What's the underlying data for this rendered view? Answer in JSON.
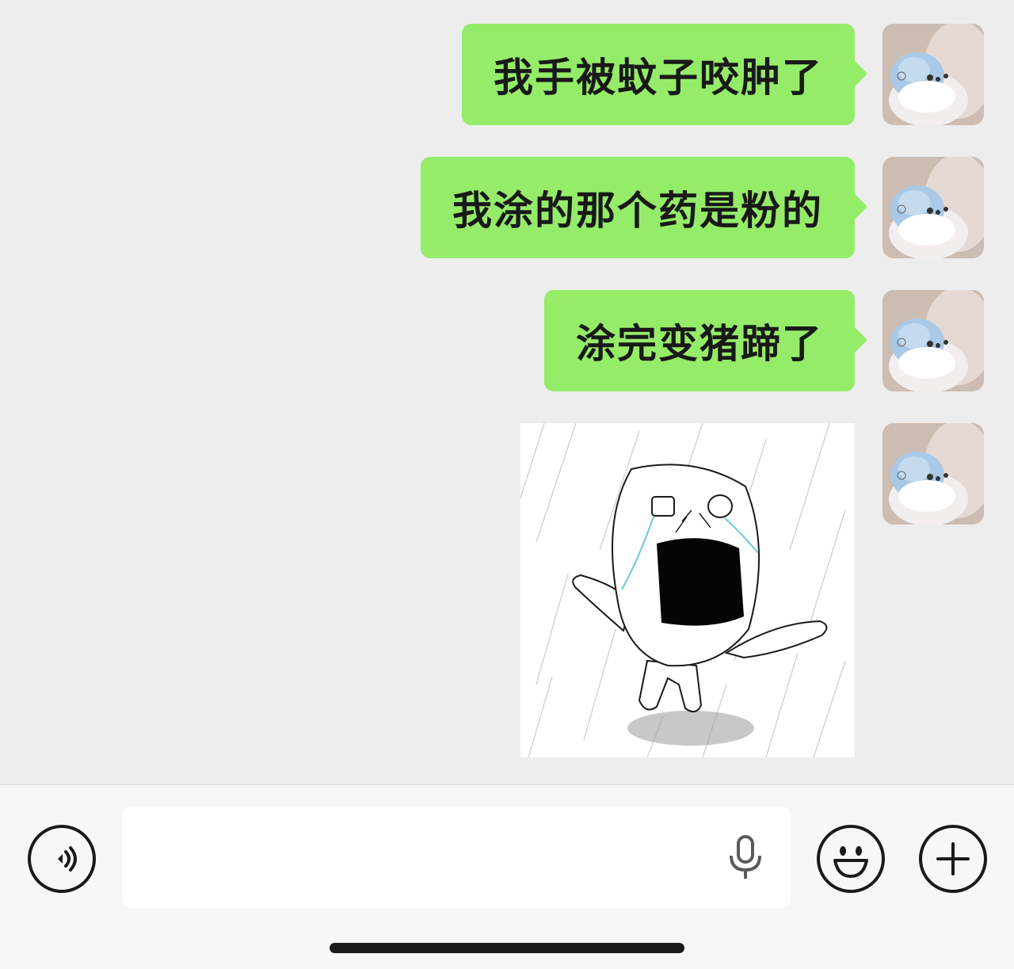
{
  "messages": [
    {
      "type": "text",
      "text": "我手被蚊子咬肿了"
    },
    {
      "type": "text",
      "text": "我涂的那个药是粉的"
    },
    {
      "type": "text",
      "text": "涂完变猪蹄了"
    },
    {
      "type": "sticker",
      "icon": "crying-face-sticker"
    }
  ],
  "input": {
    "value": "",
    "placeholder": ""
  },
  "icons": {
    "voice": "voice-mode-icon",
    "mic": "microphone-icon",
    "emoji": "emoji-icon",
    "more": "plus-icon"
  },
  "colors": {
    "bubble": "#95ec69",
    "background": "#ededed",
    "input_bar": "#f7f7f7"
  }
}
